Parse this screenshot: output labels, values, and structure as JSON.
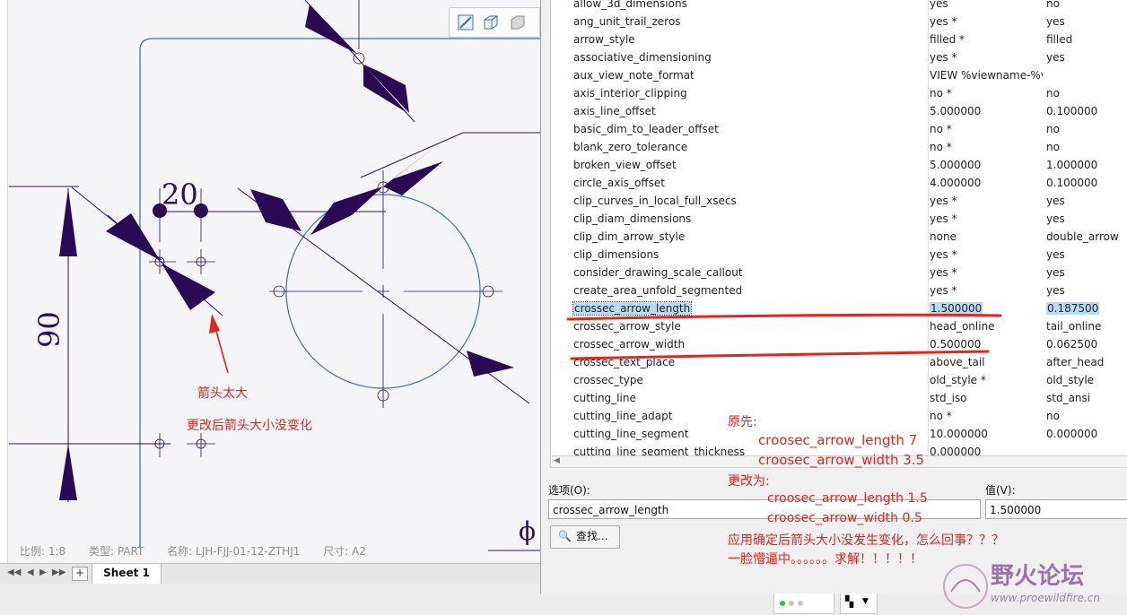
{
  "drawing": {
    "dim_20": "20",
    "dim_90": "90",
    "phi": "ϕ",
    "status": {
      "scale": "比例: 1:8",
      "type": "类型: PART",
      "name": "名称: LJH-FJJ-01-12-ZTHJ1",
      "size": "尺寸: A2"
    },
    "sheet_tab": "Sheet 1",
    "add_sheet": "+",
    "note_big": "箭头太大",
    "note_nochange": "更改后箭头大小没变化",
    "colors": {
      "geometry": "#2b0f5e",
      "arrow": "#2a0a55",
      "circle": "#3a6fb5",
      "annotation": "#e8231c"
    }
  },
  "options": {
    "rows": [
      {
        "name": "allow_3d_dimensions",
        "value": "yes",
        "default": "no"
      },
      {
        "name": "ang_unit_trail_zeros",
        "value": "yes *",
        "default": "yes"
      },
      {
        "name": "arrow_style",
        "value": "filled *",
        "default": "filled"
      },
      {
        "name": "associative_dimensioning",
        "value": "yes *",
        "default": "yes"
      },
      {
        "name": "aux_view_note_format",
        "value": "VIEW %viewname-%vi",
        "default": ""
      },
      {
        "name": "axis_interior_clipping",
        "value": "no *",
        "default": "no"
      },
      {
        "name": "axis_line_offset",
        "value": "5.000000",
        "default": "0.100000"
      },
      {
        "name": "basic_dim_to_leader_offset",
        "value": "no *",
        "default": "no"
      },
      {
        "name": "blank_zero_tolerance",
        "value": "no *",
        "default": "no"
      },
      {
        "name": "broken_view_offset",
        "value": "5.000000",
        "default": "1.000000"
      },
      {
        "name": "circle_axis_offset",
        "value": "4.000000",
        "default": "0.100000"
      },
      {
        "name": "clip_curves_in_local_full_xsecs",
        "value": "yes *",
        "default": "yes"
      },
      {
        "name": "clip_diam_dimensions",
        "value": "yes *",
        "default": "yes"
      },
      {
        "name": "clip_dim_arrow_style",
        "value": "none",
        "default": "double_arrow"
      },
      {
        "name": "clip_dimensions",
        "value": "yes *",
        "default": "yes"
      },
      {
        "name": "consider_drawing_scale_callout",
        "value": "yes *",
        "default": "yes"
      },
      {
        "name": "create_area_unfold_segmented",
        "value": "yes *",
        "default": "yes"
      },
      {
        "name": "crossec_arrow_length",
        "value": "1.500000",
        "default": "0.187500",
        "selected": true
      },
      {
        "name": "crossec_arrow_style",
        "value": "head_online",
        "default": "tail_online"
      },
      {
        "name": "crossec_arrow_width",
        "value": "0.500000",
        "default": "0.062500"
      },
      {
        "name": "crossec_text_place",
        "value": "above_tail",
        "default": "after_head"
      },
      {
        "name": "crossec_type",
        "value": "old_style *",
        "default": "old_style"
      },
      {
        "name": "cutting_line",
        "value": "std_iso",
        "default": "std_ansi"
      },
      {
        "name": "cutting_line_adapt",
        "value": "no *",
        "default": "no"
      },
      {
        "name": "cutting_line_segment",
        "value": "10.000000",
        "default": "0.000000"
      },
      {
        "name": "cutting_line_segment_thickness",
        "value": "0.000000",
        "default": ""
      }
    ],
    "option_label": "选项(O):",
    "value_label": "值(V):",
    "option_input": "crossec_arrow_length",
    "value_input": "1.500000",
    "find_button": "查找...",
    "annot": {
      "orig_title": "原先:",
      "orig_len": "croosec_arrow_length  7",
      "orig_wid": "croosec_arrow_width    3.5",
      "new_title": "更改为:",
      "new_len": "croosec_arrow_length 1.5",
      "new_wid": "croosec_arrow_width    0.5",
      "question": "应用确定后箭头大小没发生变化，怎么回事？？？",
      "sigh": "一脸懵逼中。。。。。。求解！！！！！"
    }
  },
  "watermark": {
    "text": "野火论坛",
    "url": "www.proewildfire.cn"
  }
}
